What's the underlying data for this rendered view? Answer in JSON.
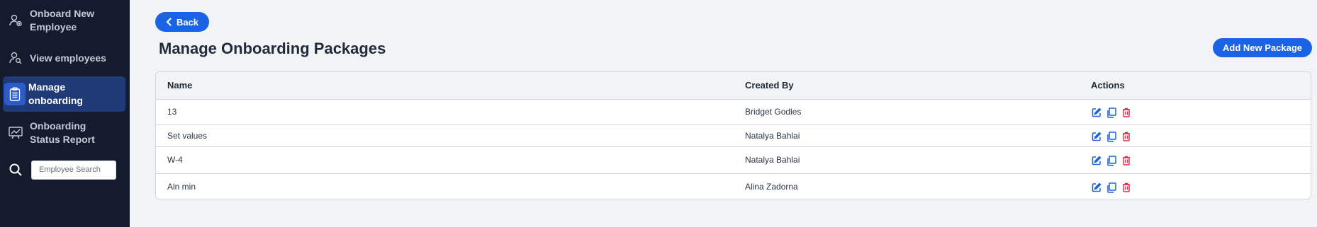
{
  "sidebar": {
    "items": [
      {
        "label": "Onboard New Employee",
        "icon": "person-add-icon",
        "active": false
      },
      {
        "label": "View employees",
        "icon": "person-search-icon",
        "active": false
      },
      {
        "label": "Manage onboarding",
        "icon": "clipboard-icon",
        "active": true
      },
      {
        "label": "Onboarding Status Report",
        "icon": "chart-board-icon",
        "active": false
      }
    ],
    "search": {
      "placeholder": "Employee Search",
      "icon": "search-icon"
    }
  },
  "header": {
    "back_label": "Back",
    "title": "Manage Onboarding Packages",
    "add_label": "Add New Package"
  },
  "table": {
    "columns": [
      "Name",
      "Created By",
      "Actions"
    ],
    "rows": [
      {
        "name": "13",
        "created_by": "Bridget Godles"
      },
      {
        "name": "Set values",
        "created_by": "Natalya Bahlai"
      },
      {
        "name": "W-4",
        "created_by": "Natalya Bahlai"
      },
      {
        "name": "Aln min",
        "created_by": "Alina Zadorna"
      }
    ],
    "action_icons": [
      "edit-icon",
      "copy-icon",
      "delete-icon"
    ]
  },
  "colors": {
    "sidebar_bg": "#141b2d",
    "accent": "#1a63e4",
    "delete": "#e0294a"
  }
}
